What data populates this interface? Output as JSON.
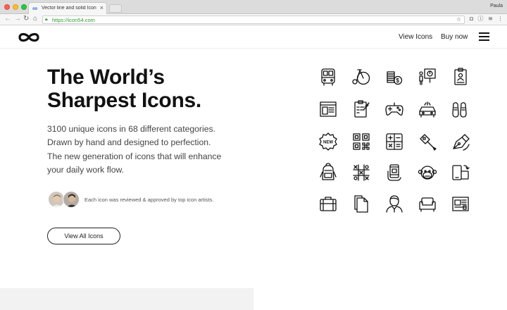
{
  "browser": {
    "tab_title": "Vector line and solid Icons collection",
    "tab_close": "×",
    "url": "https://icon54.com",
    "user": "Paula"
  },
  "header": {
    "nav": [
      "View Icons",
      "Buy now"
    ]
  },
  "hero": {
    "title_lines": [
      "The World’s",
      "Sharpest Icons."
    ],
    "description_lines": [
      "3100 unique icons in 68 different categories.",
      "Drawn by hand and designed to perfection.",
      "The new generation of icons that will enhance",
      "your daily work flow."
    ],
    "review_text": "Each icon was reviewed & approved by top icon artists.",
    "cta_label": "View All Icons"
  },
  "icons": {
    "rows": [
      [
        "bus-icon",
        "penny-farthing-icon",
        "coins-dollar-icon",
        "presentation-icon",
        "id-badge-icon"
      ],
      [
        "browser-layout-icon",
        "clipboard-checklist-icon",
        "gamepad-icon",
        "car-crash-icon",
        "sneakers-icon"
      ],
      [
        "new-badge-icon",
        "qr-code-icon",
        "calculator-icon",
        "floppy-wrench-icon",
        "pen-tool-icon"
      ],
      [
        "backpack-icon",
        "tic-tac-toe-icon",
        "smartphone-hand-icon",
        "monkey-icon",
        "device-rotate-icon"
      ],
      [
        "suitcase-icon",
        "documents-icon",
        "man-avatar-icon",
        "sofa-icon",
        "newspaper-icon"
      ]
    ],
    "new_badge_text": "NEW"
  },
  "colors": {
    "text": "#111111",
    "secure_url": "#2a9d2a",
    "footer_block": "#f2f2f2"
  }
}
